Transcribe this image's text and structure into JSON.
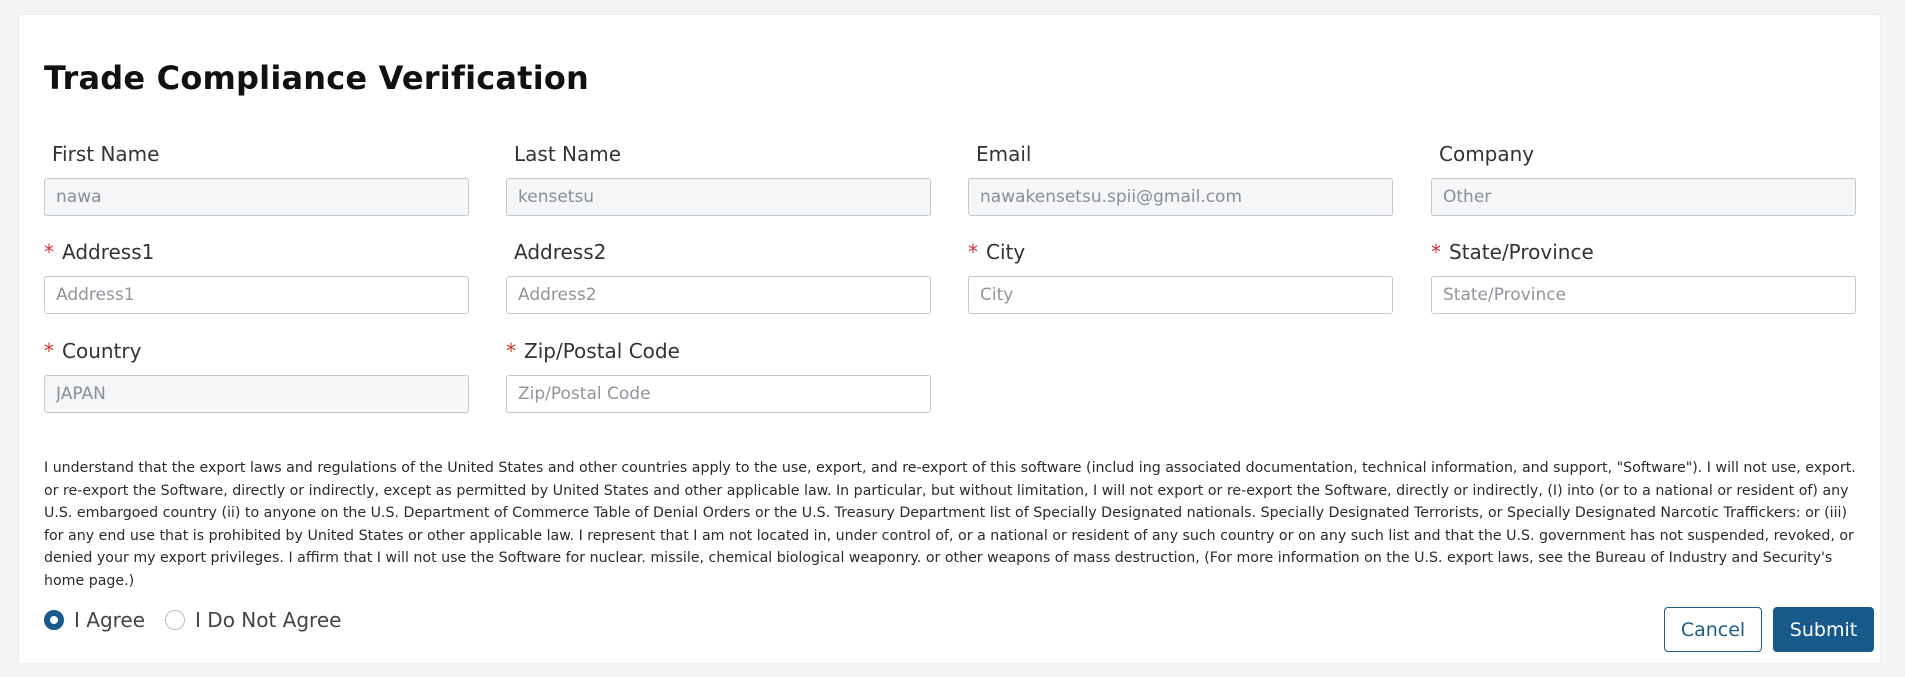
{
  "form": {
    "title": "Trade Compliance Verification",
    "fields": [
      {
        "label": "First Name",
        "required": "",
        "value": "nawa",
        "placeholder": ""
      },
      {
        "label": "Last Name",
        "required": "",
        "value": "kensetsu",
        "placeholder": ""
      },
      {
        "label": "Email",
        "required": "",
        "value": "nawakensetsu.spii@gmail.com",
        "placeholder": ""
      },
      {
        "label": "Company",
        "required": "",
        "value": "Other",
        "placeholder": ""
      },
      {
        "label": "Address1",
        "required": "*",
        "value": "",
        "placeholder": "Address1"
      },
      {
        "label": "Address2",
        "required": "",
        "value": "",
        "placeholder": "Address2"
      },
      {
        "label": "City",
        "required": "*",
        "value": "",
        "placeholder": "City"
      },
      {
        "label": "State/Province",
        "required": "*",
        "value": "",
        "placeholder": "State/Province"
      },
      {
        "label": "Country",
        "required": "*",
        "value": "JAPAN",
        "placeholder": ""
      },
      {
        "label": "Zip/Postal Code",
        "required": "*",
        "value": "",
        "placeholder": "Zip/Postal Code"
      }
    ],
    "legal_text": "I understand that the export laws and regulations of the United States and other countries apply to the use, export, and re-export of this software (includ ing associated documentation, technical information, and support, \"Software\"). I will not use, export. or re-export the Software, directly or indirectly, except as permitted by United States and other applicable law. In particular, but without limitation, I will not export or re-export the Software, directly or indirectly, (I) into (or to a national or resident of) any U.S. embargoed country (ii) to anyone on the U.S. Department of Commerce Table of Denial Orders or the U.S. Treasury Department list of Specially Designated nationals. Specially Designated Terrorists, or Specially Designated Narcotic Traffickers: or (iii) for any end use that is prohibited by United States or other applicable law. I represent that I am not located in, under control of, or a national or resident of any such country or on any such list and that the U.S. government has not suspended, revoked, or denied your my export privileges. I affirm that I will not use the Software for nuclear. missile, chemical biological weaponry. or other weapons of mass destruction, (For more information on the U.S. export laws, see the Bureau of Industry and Security's home page.)",
    "agree_label": "I Agree",
    "disagree_label": "I Do Not Agree",
    "selected_option": "I Agree",
    "cancel_label": "Cancel",
    "submit_label": "Submit"
  },
  "colors": {
    "accent": "#17598a",
    "required": "#d0342c",
    "input_border": "#c3c8cd"
  }
}
